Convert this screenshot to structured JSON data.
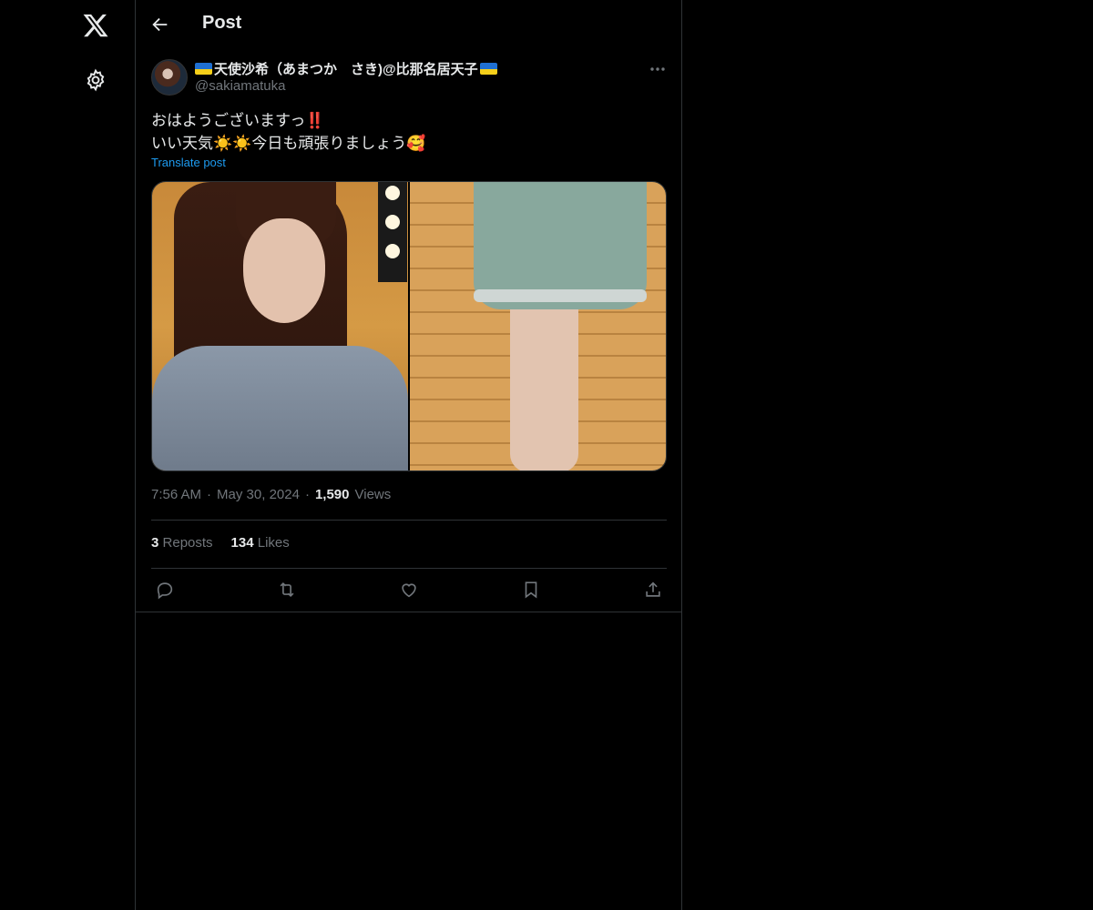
{
  "nav": {
    "logo_icon": "x-logo-icon",
    "settings_icon": "gear-icon"
  },
  "header": {
    "title": "Post",
    "back_icon": "arrow-left-icon"
  },
  "post": {
    "author": {
      "display_name": "天使沙希（あまつか　さき)@比那名居天子",
      "handle": "@sakiamatuka",
      "flag_color_top": "#1f6fd1",
      "flag_color_bottom": "#f5cf1a"
    },
    "text_line1": "おはようございますっ‼️",
    "text_line2": "いい天気☀️☀️今日も頑張りましょう🥰",
    "translate_label": "Translate post",
    "time": "7:56 AM",
    "date": "May 30, 2024",
    "views_count": "1,590",
    "views_label": "Views",
    "reposts_count": "3",
    "reposts_label": "Reposts",
    "likes_count": "134",
    "likes_label": "Likes"
  },
  "colors": {
    "background": "#000000",
    "text": "#e7e9ea",
    "muted": "#71767b",
    "accent": "#1d9bf0",
    "border": "#2f3336"
  }
}
